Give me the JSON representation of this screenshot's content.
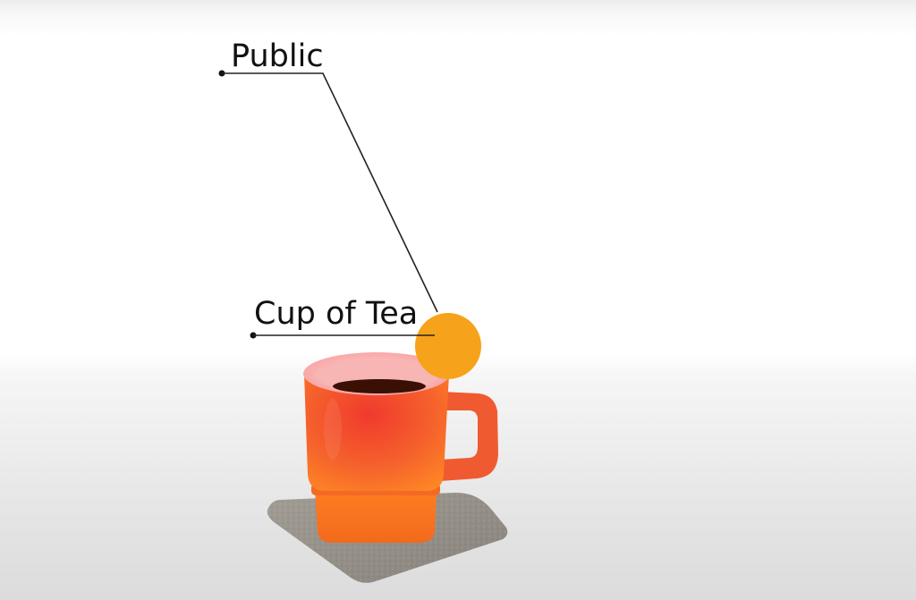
{
  "labels": {
    "public": "Public",
    "cup_of_tea": "Cup of Tea"
  },
  "colors": {
    "marker_orange": "#f7a21b",
    "mug_red": "#f0462d",
    "mug_orange": "#ff7a1f",
    "coaster_gray": "#8f8a82",
    "tea": "#3a1005",
    "leader_line": "#222222"
  },
  "icons": {
    "marker": "orange-circle",
    "object": "mug-on-coaster"
  }
}
